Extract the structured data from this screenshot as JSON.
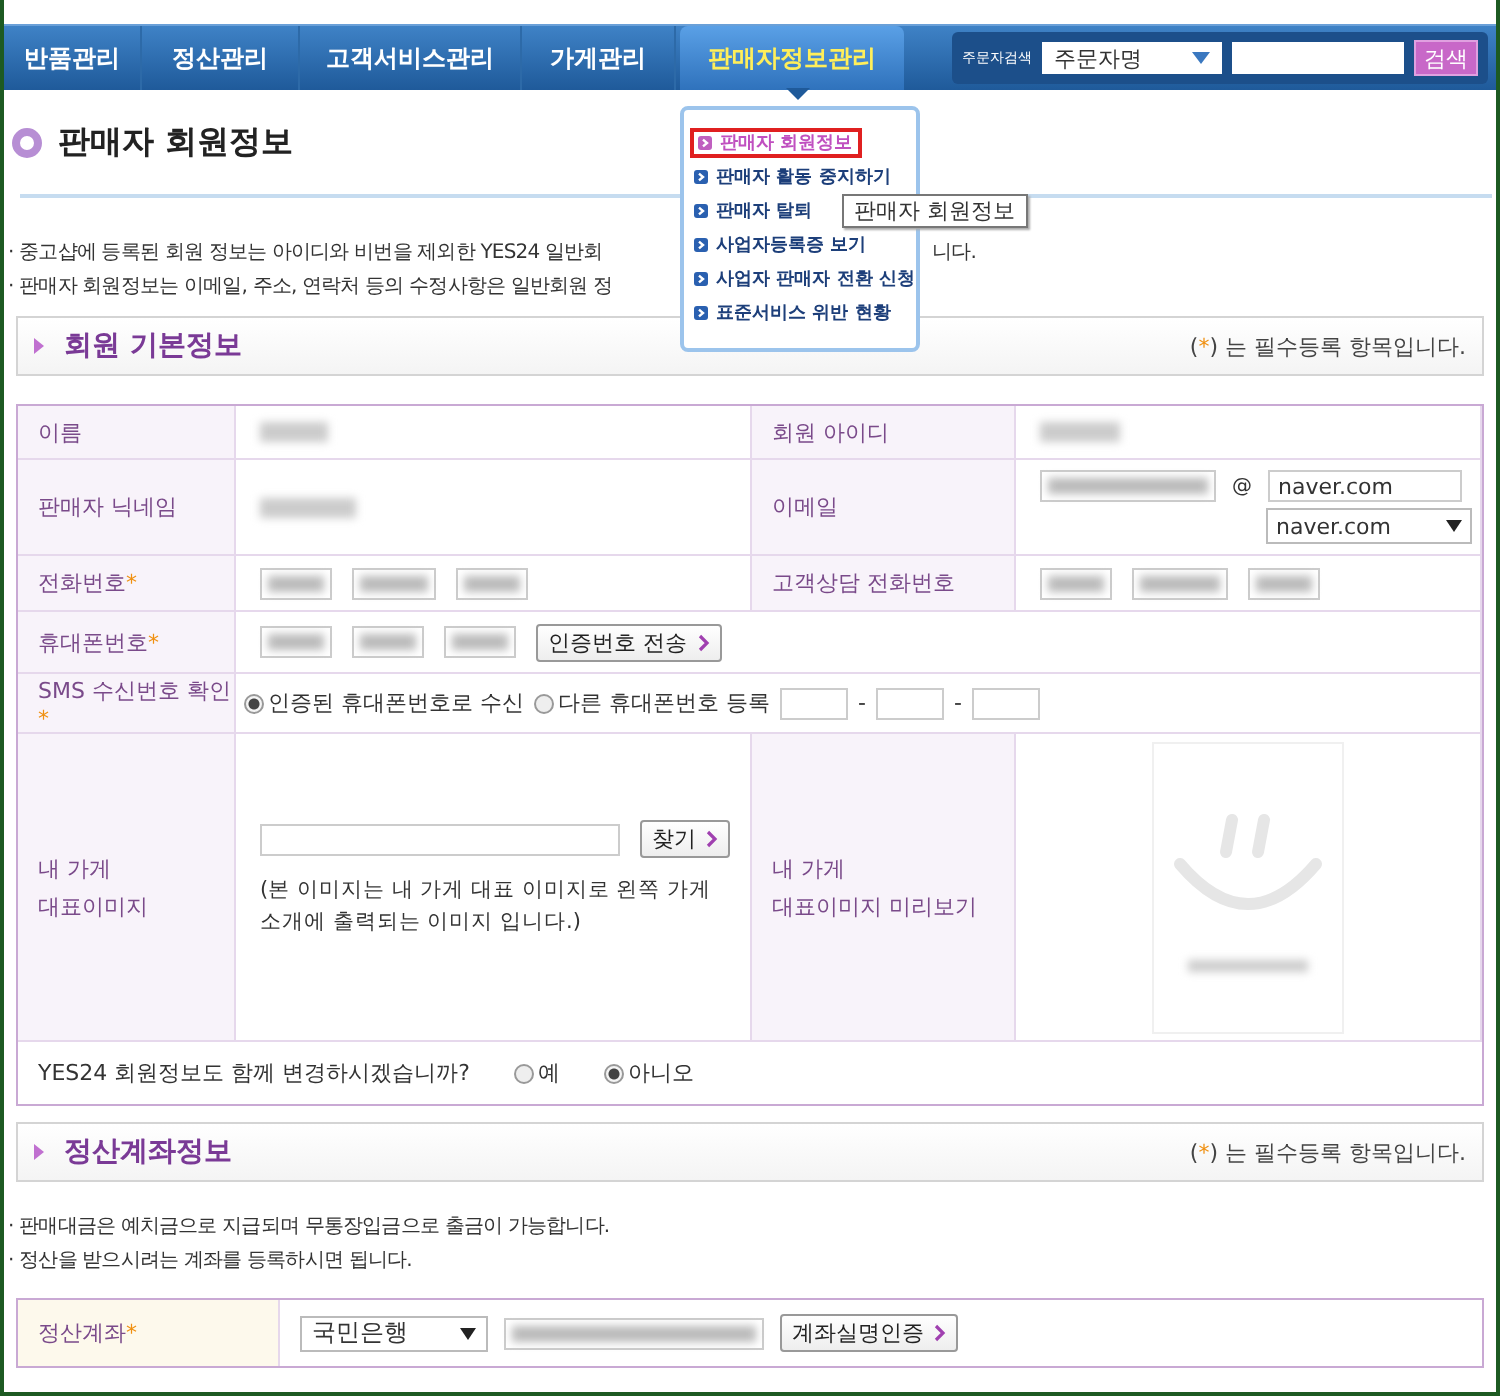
{
  "nav": {
    "tabs": [
      {
        "label": "반품관리",
        "selected": false
      },
      {
        "label": "정산관리",
        "selected": false
      },
      {
        "label": "고객서비스관리",
        "selected": false
      },
      {
        "label": "가게관리",
        "selected": false
      },
      {
        "label": "판매자정보관리",
        "selected": true
      }
    ],
    "search": {
      "label": "주문자검색",
      "select": "주문자명",
      "button": "검색"
    }
  },
  "menu": {
    "items": [
      {
        "label": "판매자 회원정보",
        "selected": true
      },
      {
        "label": "판매자 활동 중지하기",
        "selected": false
      },
      {
        "label": "판매자 탈퇴",
        "selected": false
      },
      {
        "label": "사업자등록증 보기",
        "selected": false
      },
      {
        "label": "사업자 판매자 전환 신청",
        "selected": false
      },
      {
        "label": "표준서비스 위반 현황",
        "selected": false
      }
    ],
    "tooltip": "판매자 회원정보"
  },
  "title": "판매자 회원정보",
  "notices": [
    {
      "text": "· 중고샵에 등록된 회원 정보는 아이디와 비번을 제외한 YES24 일반회",
      "tail": "니다."
    },
    {
      "text": "· 판매자 회원정보는 이메일, 주소, 연락처 등의 수정사항은 일반회원 정"
    }
  ],
  "member_section": {
    "heading": "회원 기본정보",
    "note_open": "(",
    "note_mark": "*",
    "note_close": ") 는 필수등록 항목입니다."
  },
  "member": {
    "name_label": "이름",
    "id_label": "회원 아이디",
    "nickname_label": "판매자 닉네임",
    "email_label": "이메일",
    "email_at": "@",
    "email_domain": "naver.com",
    "email_select": "naver.com",
    "phone_label": {
      "text": "전화번호",
      "mark": "*"
    },
    "support_phone_label": "고객상담 전화번호",
    "mobile_label": {
      "text": "휴대폰번호",
      "mark": "*"
    },
    "send_code_button": "인증번호 전송",
    "sms_label": {
      "text": "SMS 수신번호 확인",
      "mark": "*"
    },
    "sms_options": [
      {
        "label": "인증된 휴대폰번호로 수신",
        "selected": true
      },
      {
        "label": "다른 휴대폰번호 등록",
        "selected": false
      }
    ],
    "sms_separators": [
      "-",
      "-"
    ],
    "image_label": [
      "내 가게",
      "대표이미지"
    ],
    "find_button": "찾기",
    "image_note": "(본 이미지는 내 가게 대표 이미지로 왼쪽 가게 소개에 출력되는 이미지 입니다.)",
    "preview_label": [
      "내 가게",
      "대표이미지 미리보기"
    ],
    "yes24_question": "YES24 회원정보도 함께 변경하시겠습니까?",
    "yes24_options": [
      {
        "label": "예",
        "selected": false
      },
      {
        "label": "아니오",
        "selected": true
      }
    ]
  },
  "account_section": {
    "heading": "정산계좌정보",
    "note_open": "(",
    "note_mark": "*",
    "note_close": ") 는 필수등록 항목입니다."
  },
  "account_notices": [
    "· 판매대금은 예치금으로 지급되며 무통장입금으로 출금이 가능합니다.",
    "· 정산을 받으시려는 계좌를 등록하시면 됩니다."
  ],
  "account": {
    "label": {
      "text": "정산계좌",
      "mark": "*"
    },
    "bank": "국민은행",
    "verify_button": "계좌실명인증"
  }
}
